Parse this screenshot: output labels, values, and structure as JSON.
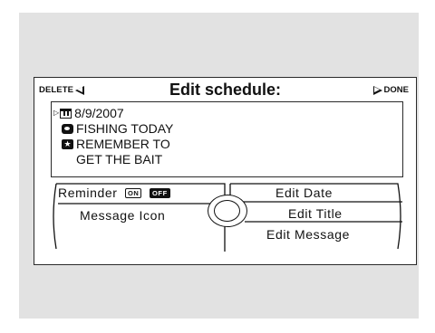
{
  "header": {
    "left_label": "DELETE",
    "title": "Edit schedule:",
    "right_label": "DONE"
  },
  "message": {
    "date": "8/9/2007",
    "line1": "FISHING TODAY",
    "line2": "REMEMBER TO",
    "line3": "GET THE BAIT",
    "icons": [
      "calendar-icon",
      "fish-icon",
      "star-icon"
    ]
  },
  "menu": {
    "reminder_label": "Reminder",
    "reminder_on": "ON",
    "reminder_off": "OFF",
    "message_icon": "Message Icon",
    "edit_date": "Edit Date",
    "edit_title": "Edit Title",
    "edit_message": "Edit Message"
  }
}
